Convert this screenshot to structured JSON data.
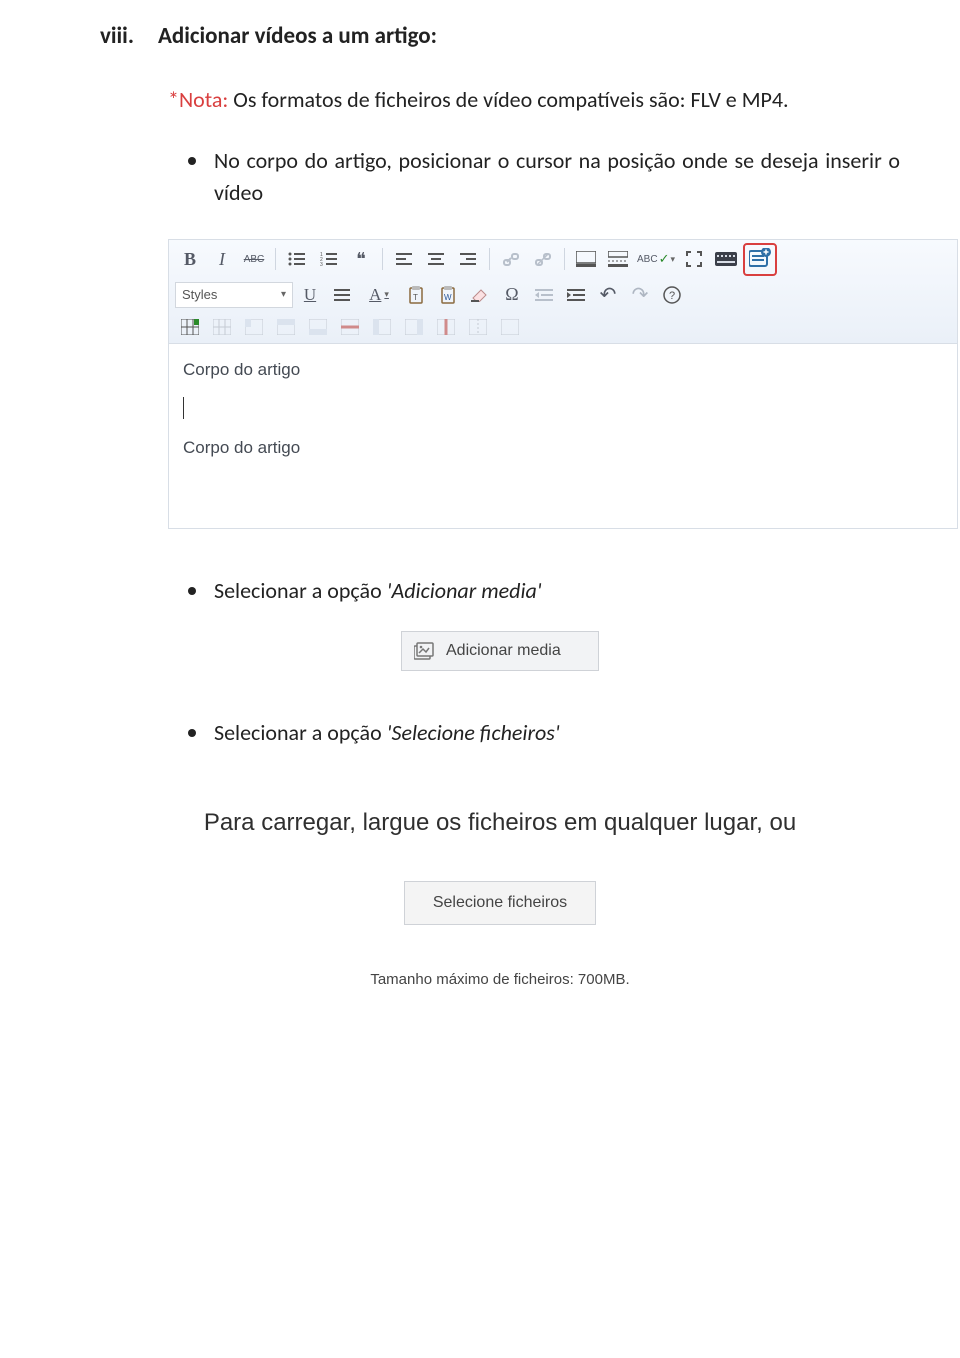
{
  "heading": {
    "index": "viii.",
    "title": "Adicionar vídeos a um artigo:"
  },
  "note": {
    "label": "*Nota:",
    "text": " Os formatos de ficheiros de vídeo compatíveis são: FLV e MP4."
  },
  "bullets": {
    "b1": "No corpo do artigo, posicionar o cursor na posição onde se deseja inserir o vídeo",
    "b2_pre": "Selecionar a opção ",
    "b2_em": "'Adicionar media'",
    "b3_pre": "Selecionar a opção ",
    "b3_em": "'Selecione ficheiros'"
  },
  "editor": {
    "styles_label": "Styles",
    "body_line1": "Corpo do artigo",
    "body_line2": "Corpo do artigo"
  },
  "icons": {
    "bold": "B",
    "italic": "I",
    "strike": "ABC",
    "bullets": "≔",
    "numbers": "1≡",
    "quote": "❝",
    "align_left": "≡",
    "align_center": "≡",
    "align_right": "≡",
    "link": "🔗",
    "unlink": "⛓",
    "image": "🖼",
    "hr": "—",
    "spell": "ABC✓",
    "fullscreen": "⛶",
    "kbd": "⌨",
    "media": "📄",
    "underline": "U",
    "A": "A",
    "paste": "📋",
    "paste_word": "W",
    "eraser": "⌫",
    "omega": "Ω",
    "outdent": "⇤",
    "indent": "⇥",
    "undo": "↶",
    "redo": "↷",
    "help": "?",
    "table": "▦",
    "chevron": "▾"
  },
  "adicionar_media_button": "Adicionar media",
  "drop_text": "Para carregar, largue os ficheiros em qualquer lugar, ou",
  "selecione_button": "Selecione ficheiros",
  "max_size": "Tamanho máximo de ficheiros: 700MB."
}
